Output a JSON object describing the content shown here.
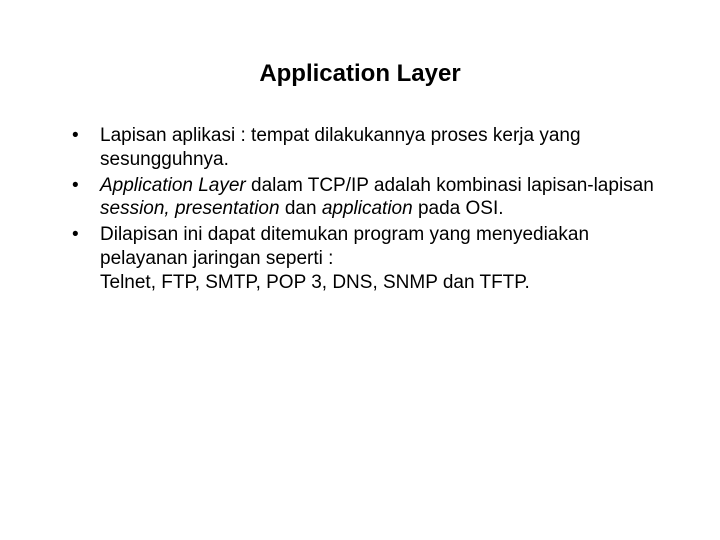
{
  "title": "Application Layer",
  "bullets": [
    {
      "prefix": "Lapisan aplikasi : tempat dilakukannya proses kerja yang sesungguhnya."
    },
    {
      "term": "Application Layer",
      "mid1": " dalam TCP/IP adalah kombinasi lapisan-lapisan ",
      "terms2": "session, presentation",
      "mid2": " dan ",
      "terms3": "application",
      "tail": " pada OSI."
    },
    {
      "line1": "Dilapisan ini dapat ditemukan program yang menyediakan pelayanan jaringan seperti :",
      "line2": "Telnet, FTP, SMTP, POP 3, DNS, SNMP dan TFTP."
    }
  ]
}
